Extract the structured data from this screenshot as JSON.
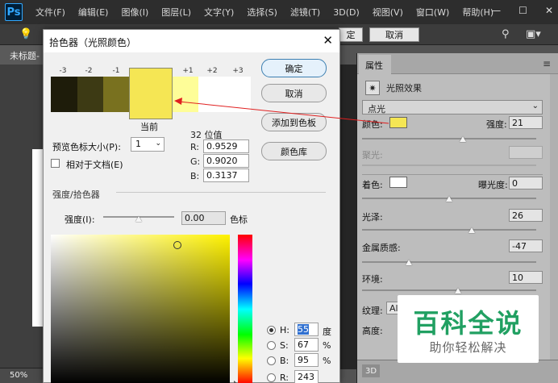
{
  "app": {
    "logo": "Ps",
    "menu": [
      "文件(F)",
      "编辑(E)",
      "图像(I)",
      "图层(L)",
      "文字(Y)",
      "选择(S)",
      "滤镜(T)",
      "3D(D)",
      "视图(V)",
      "窗口(W)",
      "帮助(H)"
    ],
    "window_controls": [
      "—",
      "☐",
      "✕"
    ]
  },
  "options_bar": {
    "ok_fragment": "定",
    "cancel_label": "取消"
  },
  "document": {
    "tab_label": "未标题-",
    "zoom": "50%"
  },
  "properties": {
    "tab_label": "属性",
    "header_label": "光照效果",
    "light_type": "点光",
    "color_label": "颜色:",
    "color_hex": "#f5e654",
    "intensity_label": "强度:",
    "intensity_value": "21",
    "intensity_level": 0.58,
    "hotspot_label": "聚光:",
    "hotspot_value": "",
    "coloring_label": "着色:",
    "coloring_hex": "#ffffff",
    "exposure_label": "曝光度:",
    "exposure_value": "0",
    "exposure_level": 0.5,
    "gloss_label": "光泽:",
    "gloss_value": "26",
    "gloss_level": 0.63,
    "metallic_label": "金属质感:",
    "metallic_value": "-47",
    "metallic_level": 0.27,
    "ambience_label": "环境:",
    "ambience_value": "10",
    "ambience_level": 0.55,
    "texture_label": "纹理:",
    "texture_value": "Al",
    "height_label": "高度:",
    "footer_tab": "3D"
  },
  "watermark": {
    "title": "百科全说",
    "subtitle": "助你轻松解决"
  },
  "dialog": {
    "title": "拾色器（光照颜色）",
    "close_icon": "✕",
    "buttons": {
      "ok": "确定",
      "cancel": "取消",
      "add_swatch": "添加到色板",
      "libraries": "颜色库"
    },
    "preview": {
      "labels": [
        "-3",
        "-2",
        "-1",
        "+1",
        "+2",
        "+3"
      ],
      "colors": [
        "#1e1c0a",
        "#3d3a14",
        "#79711f",
        "#f5e654",
        "#fefd98",
        "#ffffff",
        "#ffffff"
      ],
      "current_label": "当前"
    },
    "bits_label": "32 位值",
    "rgb": [
      {
        "label": "R:",
        "value": "0.9529"
      },
      {
        "label": "G:",
        "value": "0.9020"
      },
      {
        "label": "B:",
        "value": "0.3137"
      }
    ],
    "swatch_size_label": "预览色标大小(P):",
    "swatch_size_value": "1",
    "relative_label": "相对于文档(E)",
    "section_label": "强度/拾色器",
    "intensity_label": "强度(I):",
    "intensity_value": "0.00",
    "intensity_unit": "色标",
    "hsb": [
      {
        "label": "H:",
        "value": "55",
        "unit": "度",
        "selected": true
      },
      {
        "label": "S:",
        "value": "67",
        "unit": "%"
      },
      {
        "label": "B:",
        "value": "95",
        "unit": "%"
      },
      {
        "label": "R:",
        "value": "243",
        "unit": ""
      }
    ]
  }
}
